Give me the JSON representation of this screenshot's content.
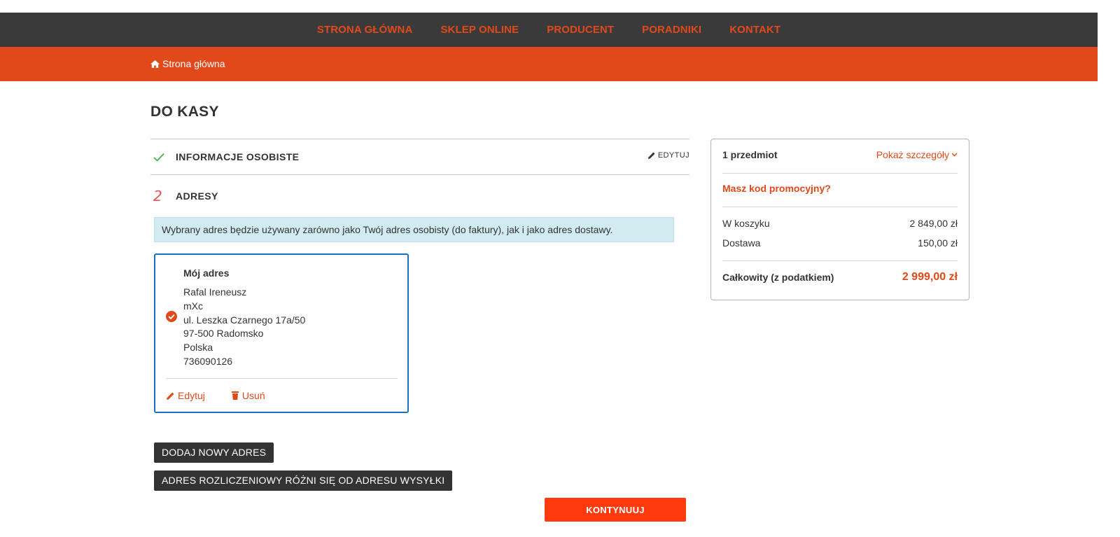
{
  "nav": {
    "items": [
      {
        "label": "STRONA GŁÓWNA"
      },
      {
        "label": "SKLEP ONLINE"
      },
      {
        "label": "PRODUCENT"
      },
      {
        "label": "PORADNIKI"
      },
      {
        "label": "KONTAKT"
      }
    ]
  },
  "breadcrumb": {
    "home_label": "Strona główna"
  },
  "page": {
    "title": "DO KASY"
  },
  "steps": {
    "personal": {
      "title": "INFORMACJE OSOBISTE",
      "edit_label": "EDYTUJ",
      "icon": "check-icon"
    },
    "addresses": {
      "number": "2",
      "title": "ADRESY"
    }
  },
  "address_notice": "Wybrany adres będzie używany zarówno jako Twój adres osobisty (do faktury), jak i jako adres dostawy.",
  "address_card": {
    "alias": "Mój adres",
    "lines": [
      "Rafal Ireneusz",
      "mXc",
      "ul. Leszka Czarnego 17a/50",
      "97-500 Radomsko",
      "Polska",
      "736090126"
    ],
    "edit_label": "Edytuj",
    "delete_label": "Usuń",
    "selected": true
  },
  "buttons": {
    "add_address": "DODAJ NOWY ADRES",
    "billing_differs": "ADRES ROZLICZENIOWY RÓŻNI SIĘ OD ADRESU WYSYŁKI",
    "continue": "KONTYNUUJ"
  },
  "summary": {
    "item_count": "1 przedmiot",
    "show_details": "Pokaż szczegóły",
    "promo": "Masz kod promocyjny?",
    "cart_label": "W koszyku",
    "cart_value": "2 849,00 zł",
    "shipping_label": "Dostawa",
    "shipping_value": "150,00 zł",
    "total_label": "Całkowity (z podatkiem)",
    "total_value": "2 999,00 zł"
  },
  "colors": {
    "accent": "#e2491a",
    "dark": "#3a3a3a",
    "selected_border": "#1a6fc4",
    "notice_bg": "#d1ecf1",
    "continue_bg": "#ff3a0e"
  }
}
